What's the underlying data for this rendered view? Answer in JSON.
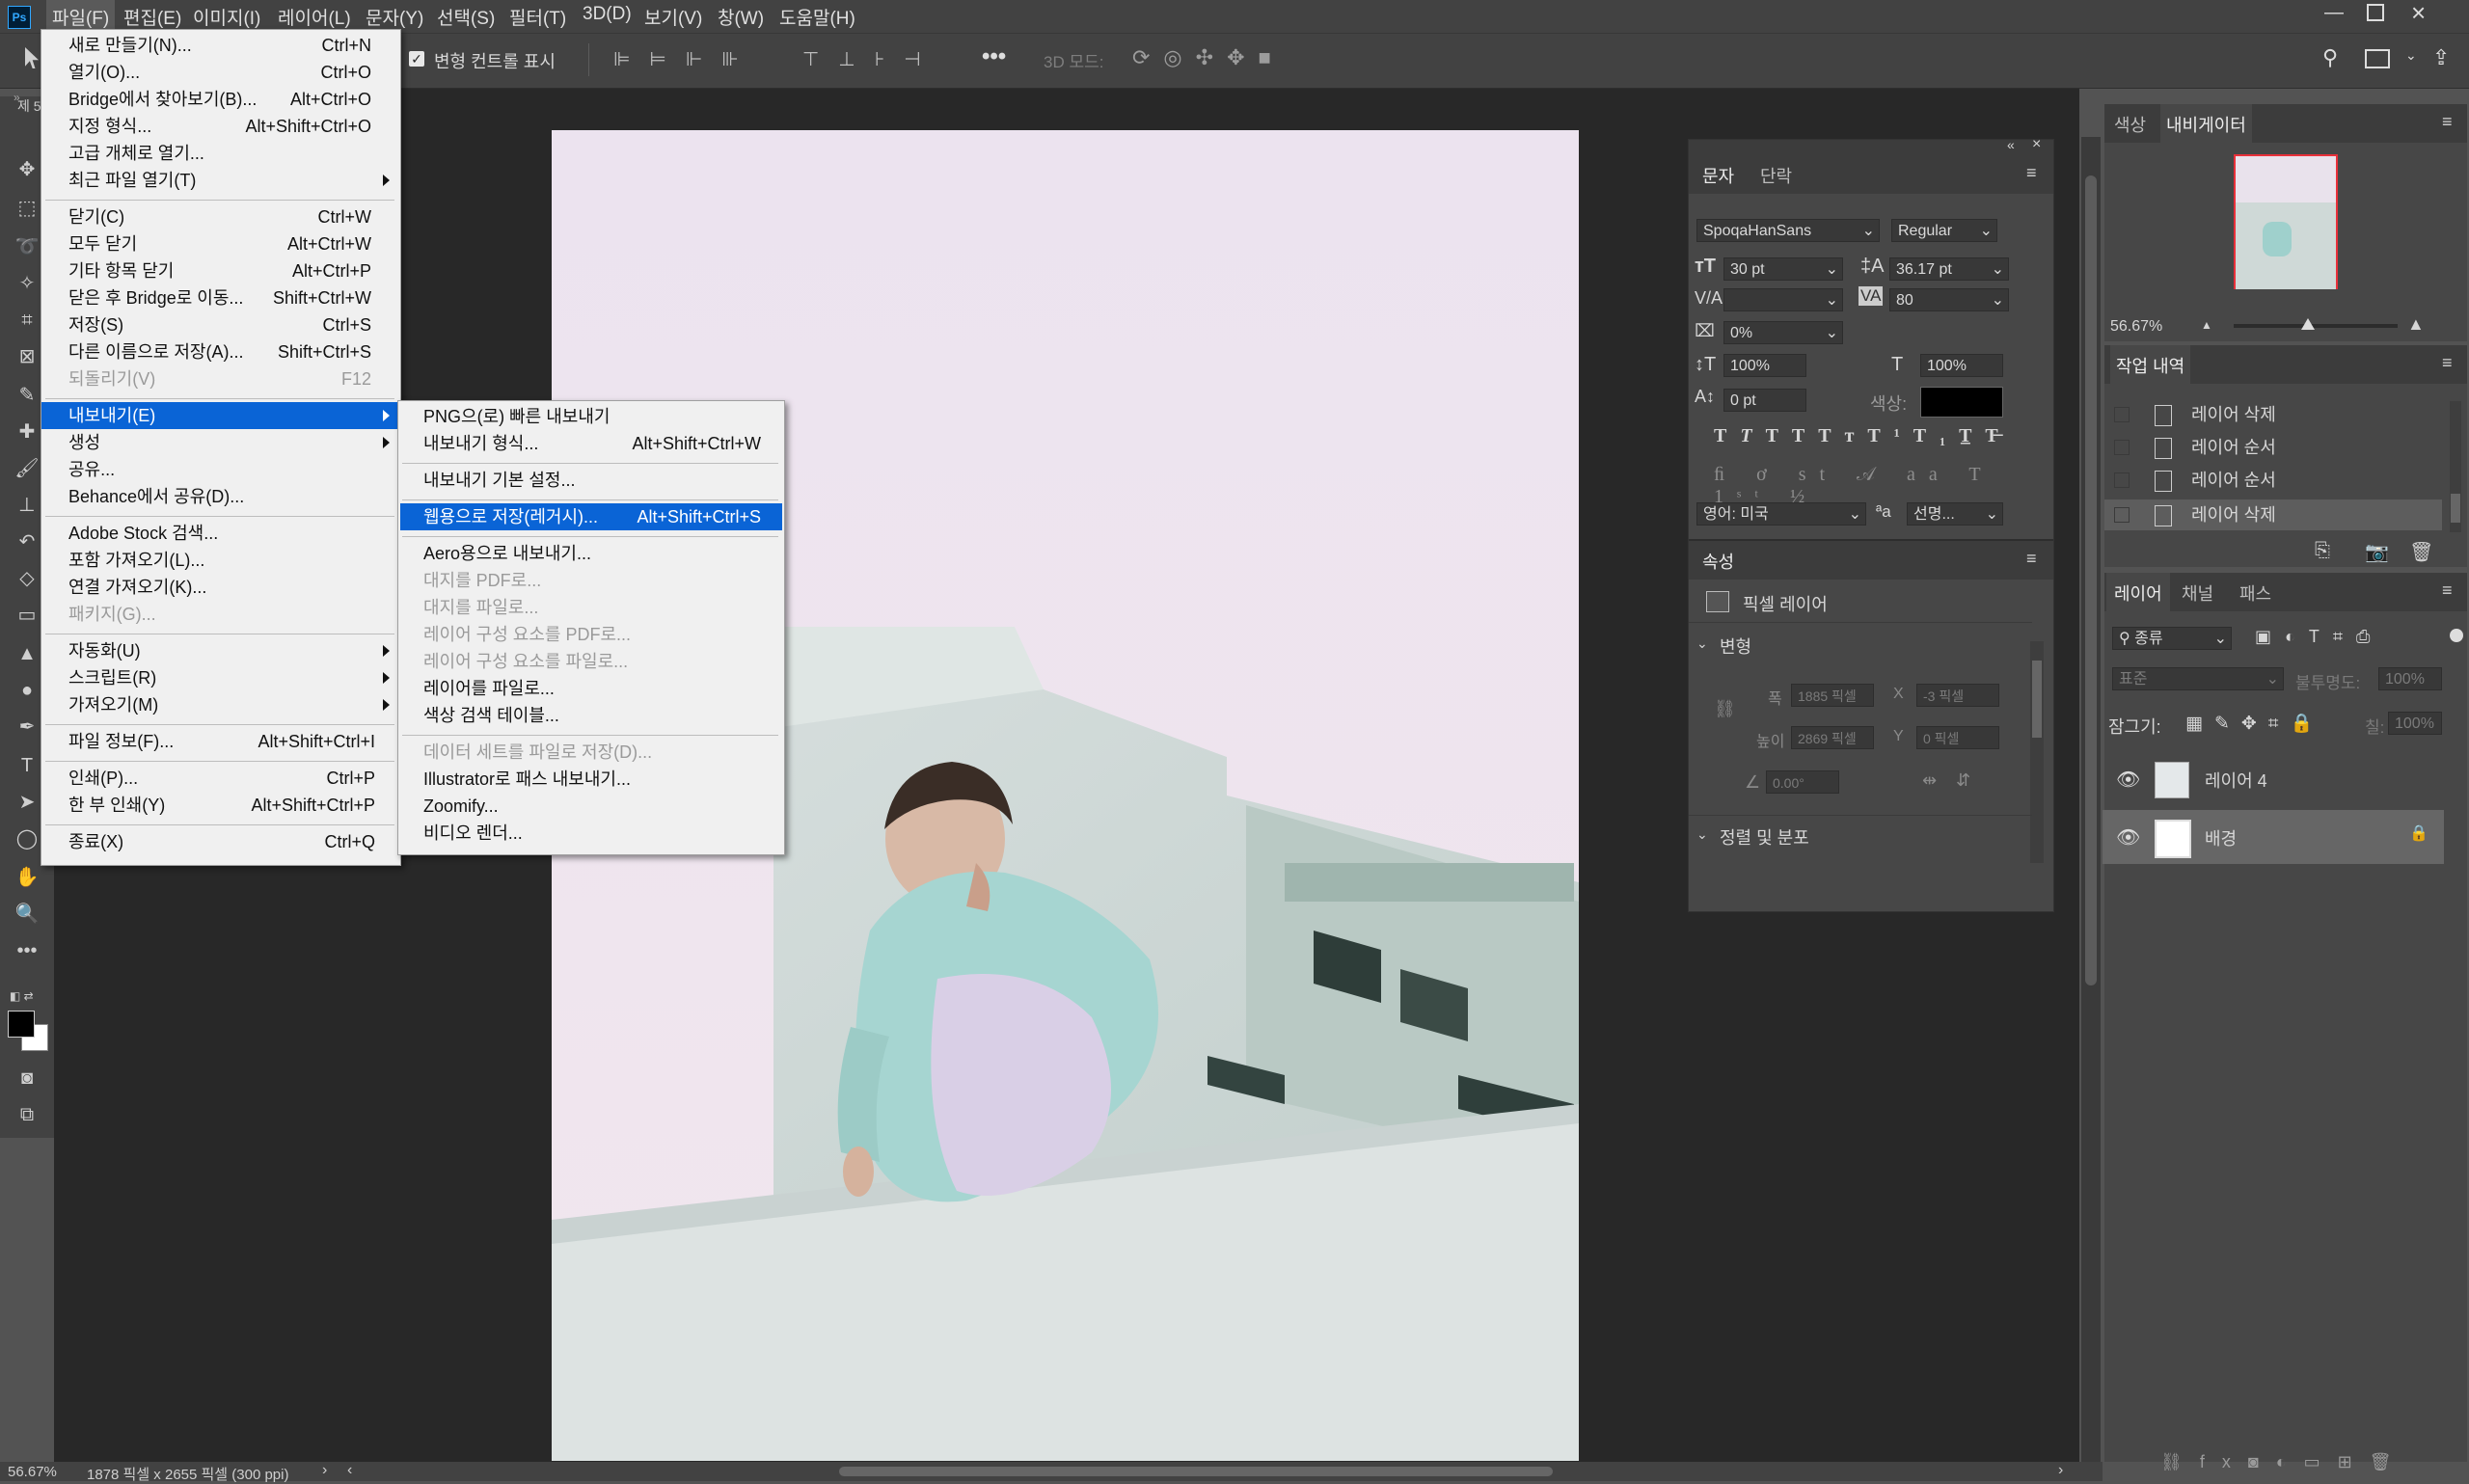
{
  "menubar": {
    "items": [
      "파일(F)",
      "편집(E)",
      "이미지(I)",
      "레이어(L)",
      "문자(Y)",
      "선택(S)",
      "필터(T)",
      "3D(D)",
      "보기(V)",
      "창(W)",
      "도움말(H)"
    ]
  },
  "options_bar": {
    "show_transform_label": "변형 컨트롤 표시",
    "mode3d_label": "3D 모드:"
  },
  "file_menu": {
    "items": [
      {
        "label": "새로 만들기(N)...",
        "shortcut": "Ctrl+N"
      },
      {
        "label": "열기(O)...",
        "shortcut": "Ctrl+O"
      },
      {
        "label": "Bridge에서 찾아보기(B)...",
        "shortcut": "Alt+Ctrl+O"
      },
      {
        "label": "지정 형식...",
        "shortcut": "Alt+Shift+Ctrl+O"
      },
      {
        "label": "고급 개체로 열기...",
        "shortcut": ""
      },
      {
        "label": "최근 파일 열기(T)",
        "shortcut": ""
      },
      {
        "label": "닫기(C)",
        "shortcut": "Ctrl+W"
      },
      {
        "label": "모두 닫기",
        "shortcut": "Alt+Ctrl+W"
      },
      {
        "label": "기타 항목 닫기",
        "shortcut": "Alt+Ctrl+P"
      },
      {
        "label": "닫은 후 Bridge로 이동...",
        "shortcut": "Shift+Ctrl+W"
      },
      {
        "label": "저장(S)",
        "shortcut": "Ctrl+S"
      },
      {
        "label": "다른 이름으로 저장(A)...",
        "shortcut": "Shift+Ctrl+S"
      },
      {
        "label": "되돌리기(V)",
        "shortcut": "F12"
      },
      {
        "label": "내보내기(E)",
        "shortcut": ""
      },
      {
        "label": "생성",
        "shortcut": ""
      },
      {
        "label": "공유...",
        "shortcut": ""
      },
      {
        "label": "Behance에서 공유(D)...",
        "shortcut": ""
      },
      {
        "label": "Adobe Stock 검색...",
        "shortcut": ""
      },
      {
        "label": "포함 가져오기(L)...",
        "shortcut": ""
      },
      {
        "label": "연결 가져오기(K)...",
        "shortcut": ""
      },
      {
        "label": "패키지(G)...",
        "shortcut": ""
      },
      {
        "label": "자동화(U)",
        "shortcut": ""
      },
      {
        "label": "스크립트(R)",
        "shortcut": ""
      },
      {
        "label": "가져오기(M)",
        "shortcut": ""
      },
      {
        "label": "파일 정보(F)...",
        "shortcut": "Alt+Shift+Ctrl+I"
      },
      {
        "label": "인쇄(P)...",
        "shortcut": "Ctrl+P"
      },
      {
        "label": "한 부 인쇄(Y)",
        "shortcut": "Alt+Shift+Ctrl+P"
      },
      {
        "label": "종료(X)",
        "shortcut": "Ctrl+Q"
      }
    ]
  },
  "export_menu": {
    "items": [
      {
        "label": "PNG으(로) 빠른 내보내기",
        "shortcut": ""
      },
      {
        "label": "내보내기 형식...",
        "shortcut": "Alt+Shift+Ctrl+W"
      },
      {
        "label": "내보내기 기본 설정...",
        "shortcut": ""
      },
      {
        "label": "웹용으로 저장(레거시)...",
        "shortcut": "Alt+Shift+Ctrl+S"
      },
      {
        "label": "Aero용으로 내보내기...",
        "shortcut": ""
      },
      {
        "label": "대지를 PDF로...",
        "shortcut": ""
      },
      {
        "label": "대지를 파일로...",
        "shortcut": ""
      },
      {
        "label": "레이어 구성 요소를 PDF로...",
        "shortcut": ""
      },
      {
        "label": "레이어 구성 요소를 파일로...",
        "shortcut": ""
      },
      {
        "label": "레이어를 파일로...",
        "shortcut": ""
      },
      {
        "label": "색상 검색 테이블...",
        "shortcut": ""
      },
      {
        "label": "데이터 세트를 파일로 저장(D)...",
        "shortcut": ""
      },
      {
        "label": "Illustrator로 패스 내보내기...",
        "shortcut": ""
      },
      {
        "label": "Zoomify...",
        "shortcut": ""
      },
      {
        "label": "비디오 렌더...",
        "shortcut": ""
      }
    ]
  },
  "character_panel": {
    "tabs": [
      "문자",
      "단락"
    ],
    "font_family": "SpoqaHanSans",
    "font_style": "Regular",
    "font_size": "30 pt",
    "leading": "36.17 pt",
    "kerning": "",
    "tracking": "80",
    "tsume": "0%",
    "vertical_scale": "100%",
    "horizontal_scale": "100%",
    "baseline_shift": "0 pt",
    "color_label": "색상:",
    "language": "영어: 미국",
    "aa_label": "ªa",
    "antialias": "선명..."
  },
  "properties_panel": {
    "title": "속성",
    "layer_type": "픽셀 레이어",
    "transform_title": "변형",
    "width_label": "폭",
    "width": "1885 픽셀",
    "x_label": "X",
    "x": "-3 픽셀",
    "height_label": "높이",
    "height": "2869 픽셀",
    "y_label": "Y",
    "y": "0 픽셀",
    "angle": "0.00°",
    "align_title": "정렬 및 분포"
  },
  "navigator_panel": {
    "tabs": [
      "색상",
      "내비게이터"
    ],
    "zoom": "56.67%"
  },
  "history_panel": {
    "title": "작업 내역",
    "items": [
      "레이어 삭제",
      "레이어 순서",
      "레이어 순서",
      "레이어 삭제"
    ]
  },
  "layers_panel": {
    "tabs": [
      "레이어",
      "채널",
      "패스"
    ],
    "filter": "종류",
    "blend_mode": "표준",
    "opacity_label": "불투명도:",
    "opacity": "100%",
    "lock_label": "잠그기:",
    "fill_label": "칠:",
    "fill": "100%",
    "layers": [
      {
        "name": "레이어 4"
      },
      {
        "name": "배경"
      }
    ]
  },
  "status": {
    "zoom": "56.67%",
    "doc_info": "1878 픽셀 x 2655 픽셀 (300 ppi)"
  },
  "doc_tab_fragment": "제 5"
}
